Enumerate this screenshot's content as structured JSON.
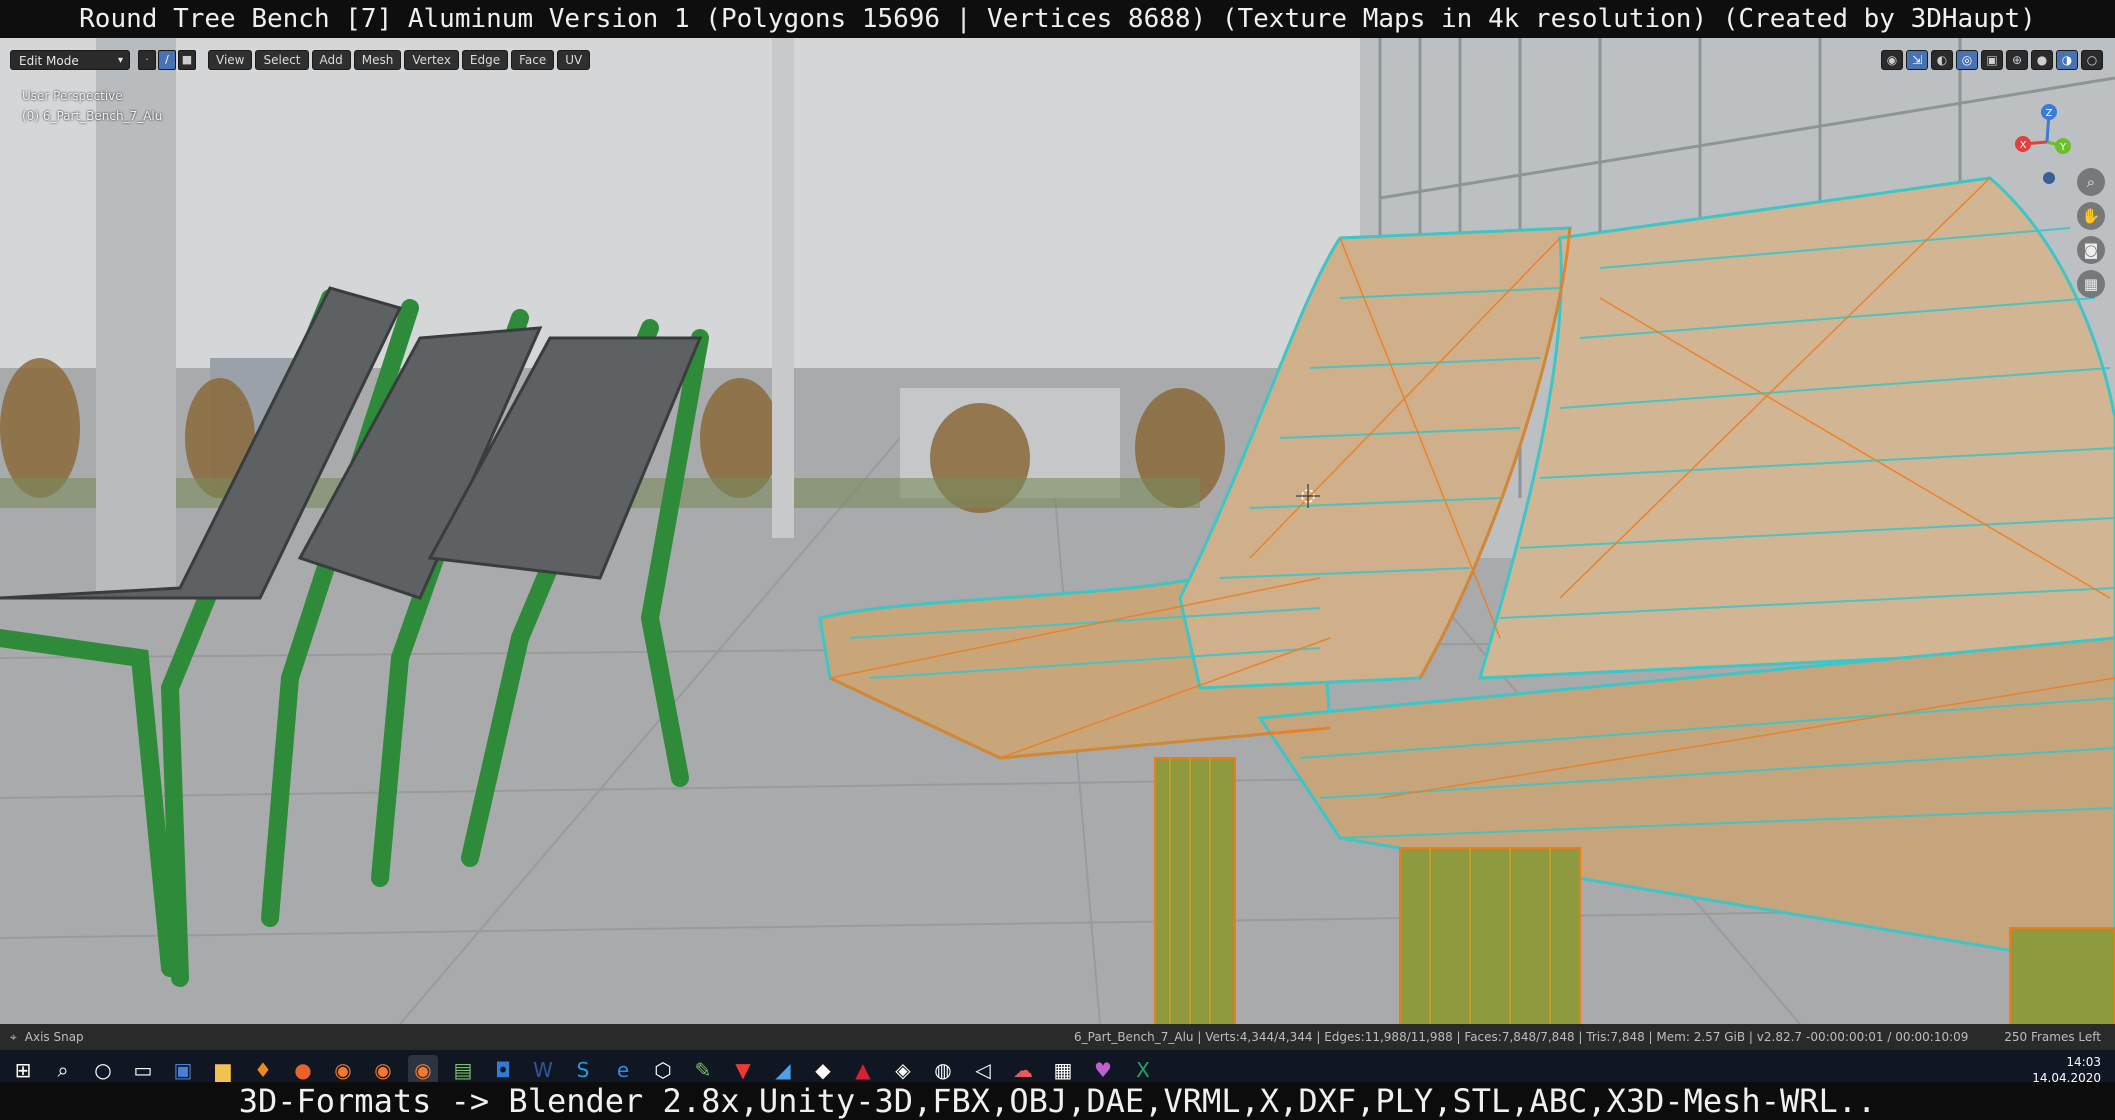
{
  "window": {
    "title": "Round Tree Bench [7] Aluminum Version 1 (Polygons 15696 | Vertices 8688) (Texture Maps in 4k resolution) (Created by 3DHaupt)"
  },
  "header": {
    "mode": "Edit Mode",
    "menus": [
      "View",
      "Select",
      "Add",
      "Mesh",
      "Vertex",
      "Edge",
      "Face",
      "UV"
    ]
  },
  "viewport": {
    "perspective": "User Perspective",
    "object": "(0) 6_Part_Bench_7_Alu",
    "gizmo_axes": [
      "X",
      "Y",
      "Z"
    ],
    "colors": {
      "object_green": "#2e8b3a",
      "wood": "#c8a67a",
      "edge_cyan": "#3bc6c8",
      "edge_orange": "#f07a1a"
    }
  },
  "status": {
    "hint": "Axis Snap",
    "stats": "6_Part_Bench_7_Alu | Verts:4,344/4,344 | Edges:11,988/11,988 | Faces:7,848/7,848 | Tris:7,848 | Mem: 2.57 GiB | v2.82.7",
    "time": "-00:00:00:01 / 00:00:10:09",
    "frames": "250 Frames Left"
  },
  "taskbar": {
    "time": "14:03",
    "date": "14.04.2020"
  },
  "caption": "3D-Formats -> Blender 2.8x,Unity-3D,FBX,OBJ,DAE,VRML,X,DXF,PLY,STL,ABC,X3D-Mesh-WRL.."
}
